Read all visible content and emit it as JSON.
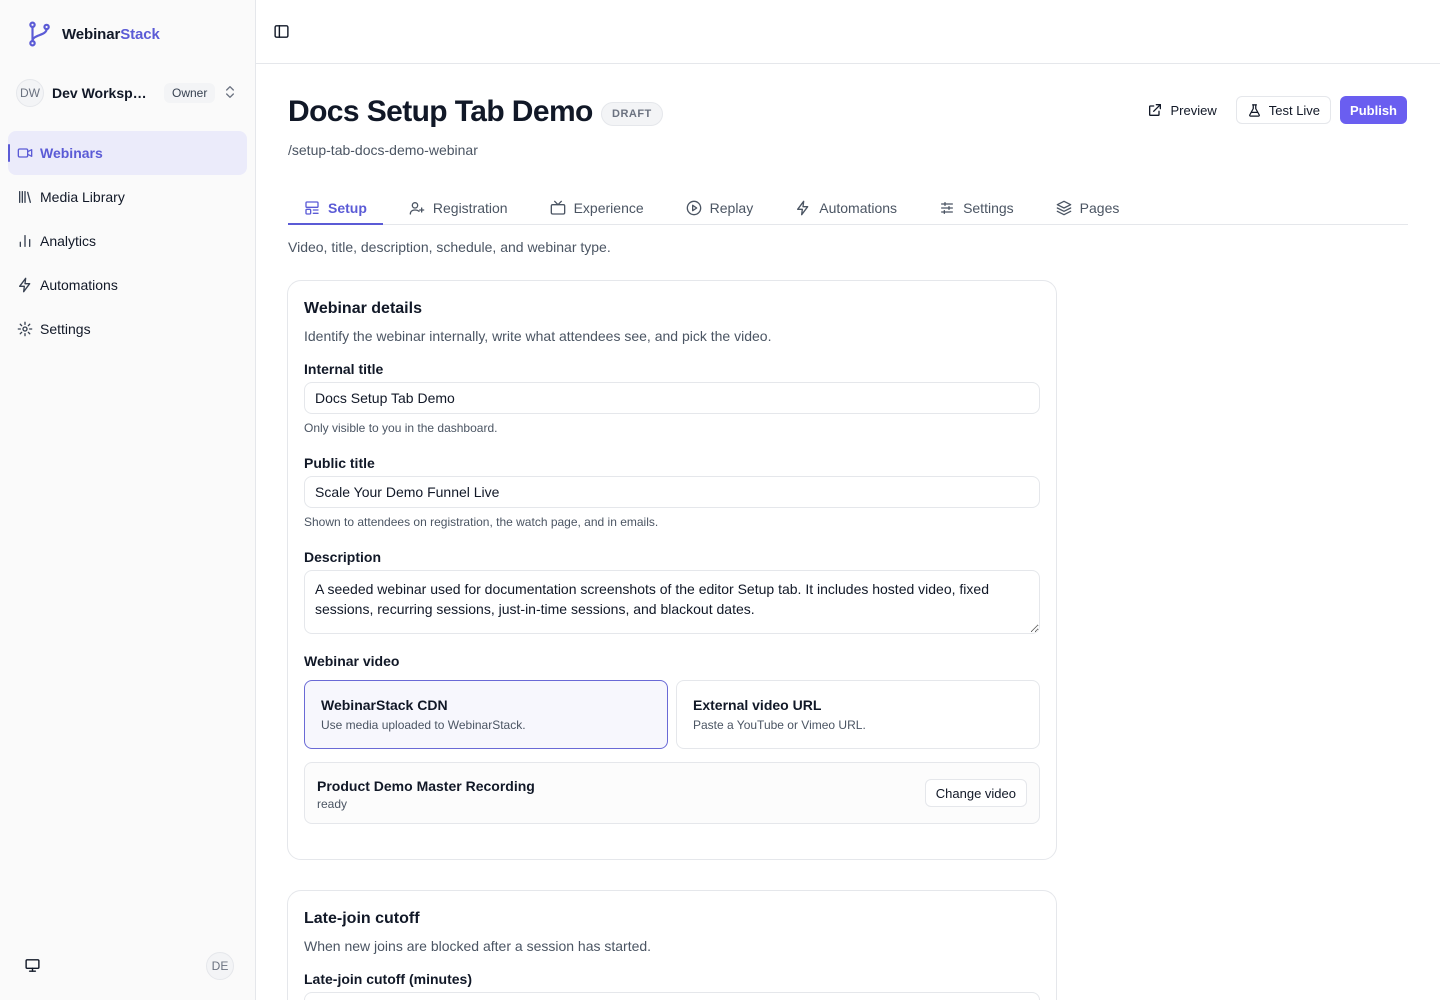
{
  "brand": {
    "name_main": "Webinar",
    "name_accent": "Stack",
    "accent_color": "#5b5bd6",
    "logo_icon": "branch-icon"
  },
  "workspace": {
    "initials": "DW",
    "name": "Dev Workspace",
    "role": "Owner"
  },
  "sidebar": {
    "items": [
      {
        "label": "Webinars",
        "icon": "video-icon",
        "active": true
      },
      {
        "label": "Media Library",
        "icon": "library-icon",
        "active": false
      },
      {
        "label": "Analytics",
        "icon": "bar-chart-icon",
        "active": false
      },
      {
        "label": "Automations",
        "icon": "bolt-icon",
        "active": false
      },
      {
        "label": "Settings",
        "icon": "gear-icon",
        "active": false
      }
    ],
    "footer_avatar": "DE"
  },
  "header": {
    "title": "Docs Setup Tab Demo",
    "status": "DRAFT",
    "slug": "/setup-tab-docs-demo-webinar",
    "actions": {
      "preview": "Preview",
      "test_live": "Test Live",
      "publish": "Publish"
    },
    "primary_color": "#6a5ef0"
  },
  "tabs": [
    {
      "label": "Setup",
      "icon": "layout-icon",
      "active": true
    },
    {
      "label": "Registration",
      "icon": "user-plus-icon",
      "active": false
    },
    {
      "label": "Experience",
      "icon": "tv-icon",
      "active": false
    },
    {
      "label": "Replay",
      "icon": "play-circle-icon",
      "active": false
    },
    {
      "label": "Automations",
      "icon": "bolt-icon",
      "active": false
    },
    {
      "label": "Settings",
      "icon": "sliders-icon",
      "active": false
    },
    {
      "label": "Pages",
      "icon": "layers-icon",
      "active": false
    }
  ],
  "tab_description": "Video, title, description, schedule, and webinar type.",
  "webinar_details": {
    "title": "Webinar details",
    "subtitle": "Identify the webinar internally, write what attendees see, and pick the video.",
    "internal_title": {
      "label": "Internal title",
      "value": "Docs Setup Tab Demo",
      "help": "Only visible to you in the dashboard."
    },
    "public_title": {
      "label": "Public title",
      "value": "Scale Your Demo Funnel Live",
      "help": "Shown to attendees on registration, the watch page, and in emails."
    },
    "description": {
      "label": "Description",
      "value": "A seeded webinar used for documentation screenshots of the editor Setup tab. It includes hosted video, fixed sessions, recurring sessions, just-in-time sessions, and blackout dates."
    },
    "video": {
      "label": "Webinar video",
      "options": [
        {
          "title": "WebinarStack CDN",
          "subtitle": "Use media uploaded to WebinarStack.",
          "selected": true
        },
        {
          "title": "External video URL",
          "subtitle": "Paste a YouTube or Vimeo URL.",
          "selected": false
        }
      ],
      "media_name": "Product Demo Master Recording",
      "media_status": "ready",
      "change_label": "Change video"
    }
  },
  "late_join": {
    "title": "Late-join cutoff",
    "subtitle": "When new joins are blocked after a session has started.",
    "field_label": "Late-join cutoff (minutes)"
  }
}
